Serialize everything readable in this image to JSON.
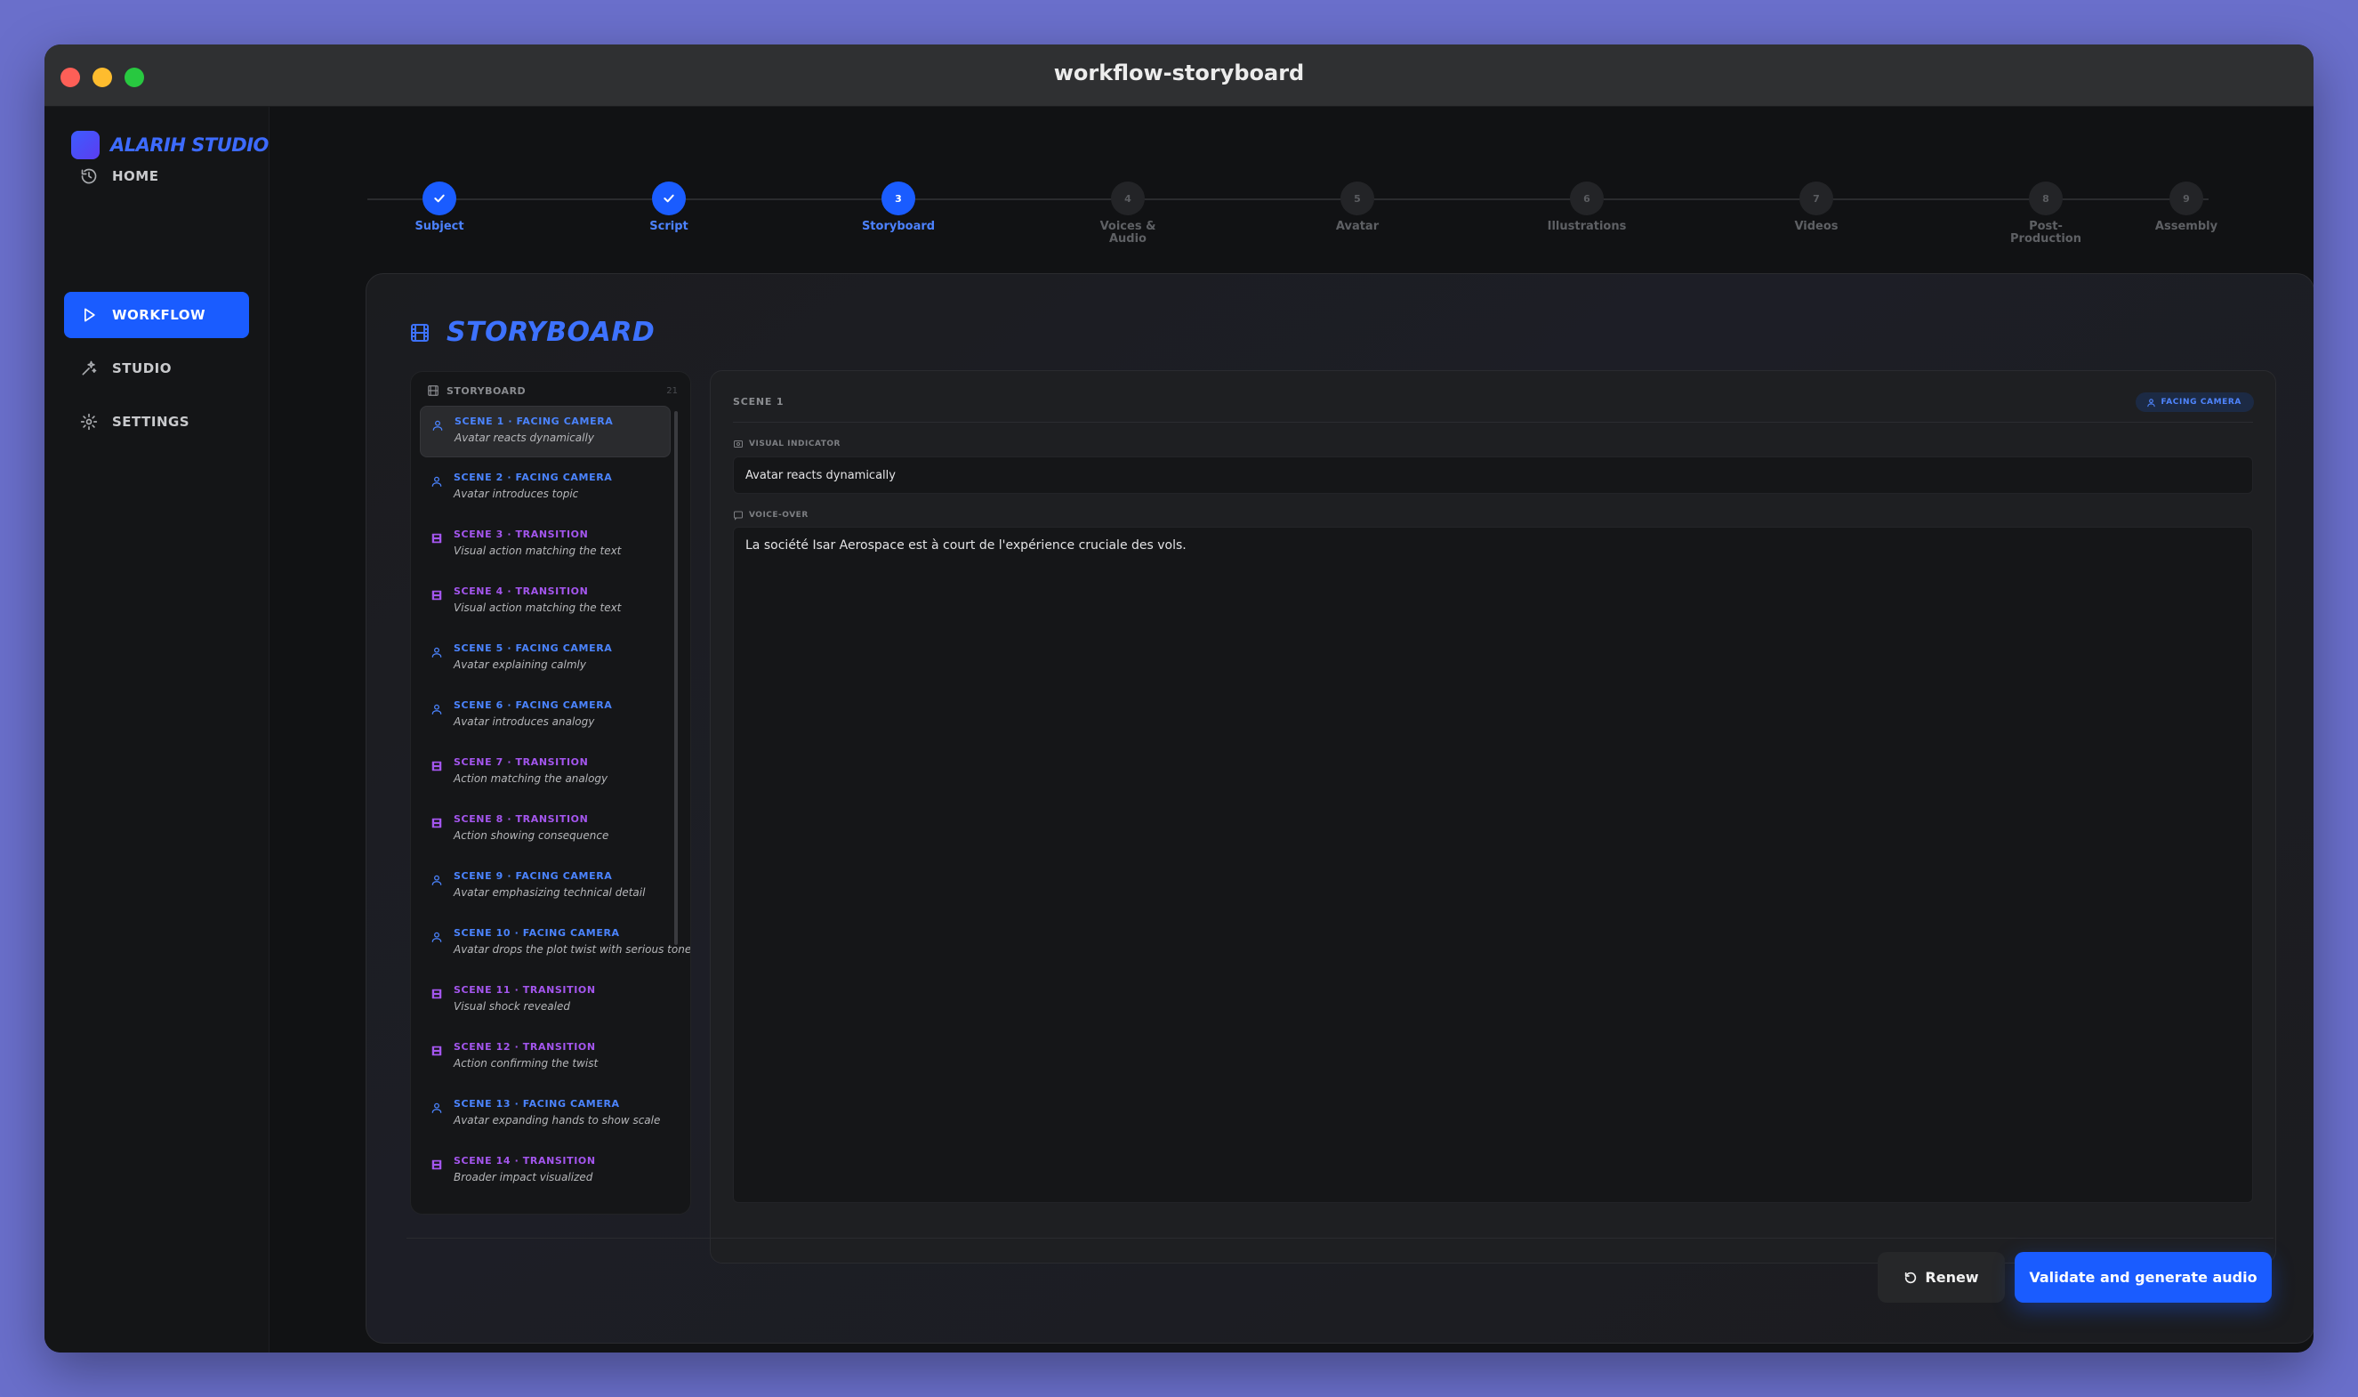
{
  "window": {
    "title": "workflow-storyboard"
  },
  "app": {
    "name": "ALARIH STUDIO"
  },
  "nav": [
    {
      "label": "HOME",
      "icon": "history-icon",
      "active": false
    },
    {
      "label": "WORKFLOW",
      "icon": "play-icon",
      "active": true
    },
    {
      "label": "STUDIO",
      "icon": "sparkles-icon",
      "active": false
    },
    {
      "label": "SETTINGS",
      "icon": "gear-icon",
      "active": false
    }
  ],
  "steps": [
    {
      "num": "1",
      "label": "Subject",
      "state": "done"
    },
    {
      "num": "2",
      "label": "Script",
      "state": "done"
    },
    {
      "num": "3",
      "label": "Storyboard",
      "state": "current"
    },
    {
      "num": "4",
      "label": "Voices &\nAudio",
      "state": "pending"
    },
    {
      "num": "5",
      "label": "Avatar",
      "state": "pending"
    },
    {
      "num": "6",
      "label": "Illustrations",
      "state": "pending"
    },
    {
      "num": "7",
      "label": "Videos",
      "state": "pending"
    },
    {
      "num": "8",
      "label": "Post-\nProduction",
      "state": "pending"
    },
    {
      "num": "9",
      "label": "Assembly",
      "state": "pending"
    }
  ],
  "page": {
    "title": "STORYBOARD"
  },
  "list": {
    "header": "STORYBOARD",
    "count": "21",
    "scenes": [
      {
        "name": "SCENE 1 · FACING CAMERA",
        "desc": "Avatar reacts dynamically",
        "kind": "cam"
      },
      {
        "name": "SCENE 2 · FACING CAMERA",
        "desc": "Avatar introduces topic",
        "kind": "cam"
      },
      {
        "name": "SCENE 3 · TRANSITION",
        "desc": "Visual action matching the text",
        "kind": "trans"
      },
      {
        "name": "SCENE 4 · TRANSITION",
        "desc": "Visual action matching the text",
        "kind": "trans"
      },
      {
        "name": "SCENE 5 · FACING CAMERA",
        "desc": "Avatar explaining calmly",
        "kind": "cam"
      },
      {
        "name": "SCENE 6 · FACING CAMERA",
        "desc": "Avatar introduces analogy",
        "kind": "cam"
      },
      {
        "name": "SCENE 7 · TRANSITION",
        "desc": "Action matching the analogy",
        "kind": "trans"
      },
      {
        "name": "SCENE 8 · TRANSITION",
        "desc": "Action showing consequence",
        "kind": "trans"
      },
      {
        "name": "SCENE 9 · FACING CAMERA",
        "desc": "Avatar emphasizing technical detail",
        "kind": "cam"
      },
      {
        "name": "SCENE 10 · FACING CAMERA",
        "desc": "Avatar drops the plot twist with serious tone",
        "kind": "cam"
      },
      {
        "name": "SCENE 11 · TRANSITION",
        "desc": "Visual shock revealed",
        "kind": "trans"
      },
      {
        "name": "SCENE 12 · TRANSITION",
        "desc": "Action confirming the twist",
        "kind": "trans"
      },
      {
        "name": "SCENE 13 · FACING CAMERA",
        "desc": "Avatar expanding hands to show scale",
        "kind": "cam"
      },
      {
        "name": "SCENE 14 · TRANSITION",
        "desc": "Broader impact visualized",
        "kind": "trans"
      }
    ]
  },
  "detail": {
    "scene_title": "SCENE 1",
    "badge": "FACING CAMERA",
    "visual_label": "VISUAL INDICATOR",
    "visual_value": "Avatar reacts dynamically",
    "voice_label": "VOICE-OVER",
    "voice_value": "La société Isar Aerospace est à court de l'expérience cruciale des vols."
  },
  "actions": {
    "renew": "Renew",
    "validate": "Validate and generate audio"
  },
  "colors": {
    "accent": "#1a5cff",
    "camera": "#4b84ff",
    "transition": "#a456ee"
  }
}
